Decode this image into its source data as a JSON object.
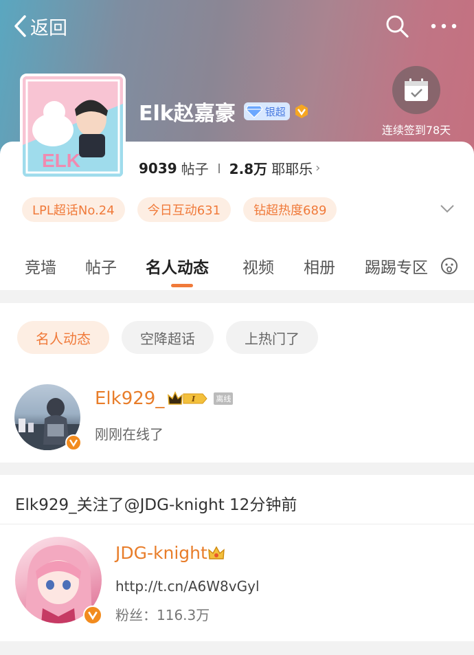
{
  "topbar": {
    "back_label": "返回",
    "search_icon": "search-icon",
    "more_icon": "more-icon"
  },
  "profile": {
    "name": "Elk赵嘉豪",
    "badge_label": "银超",
    "checkin_label": "连续签到78天",
    "posts_count": "9039",
    "posts_label": "帖子",
    "fans_count": "2.8万",
    "fans_label": "耶耶乐",
    "pills": [
      "LPL超话No.24",
      "今日互动631",
      "钻超热度689"
    ]
  },
  "tabs": [
    "竞墙",
    "帖子",
    "名人动态",
    "视频",
    "相册",
    "踢踢专区"
  ],
  "active_tab": "名人动态",
  "subtabs": [
    "名人动态",
    "空降超话",
    "上热门了"
  ],
  "online_user": {
    "name": "Elk929_",
    "level": "I",
    "offline_tag": "离线",
    "status": "刚刚在线了"
  },
  "follow_event": {
    "text": "Elk929_关注了@JDG-knight 12分钟前",
    "user_name": "JDG-knight",
    "link": "http://t.cn/A6W8vGyl",
    "fans": "粉丝：116.3万"
  },
  "colors": {
    "accent": "#f07a3a",
    "name_orange": "#e87d2a",
    "pill_bg": "#fdeee3"
  }
}
